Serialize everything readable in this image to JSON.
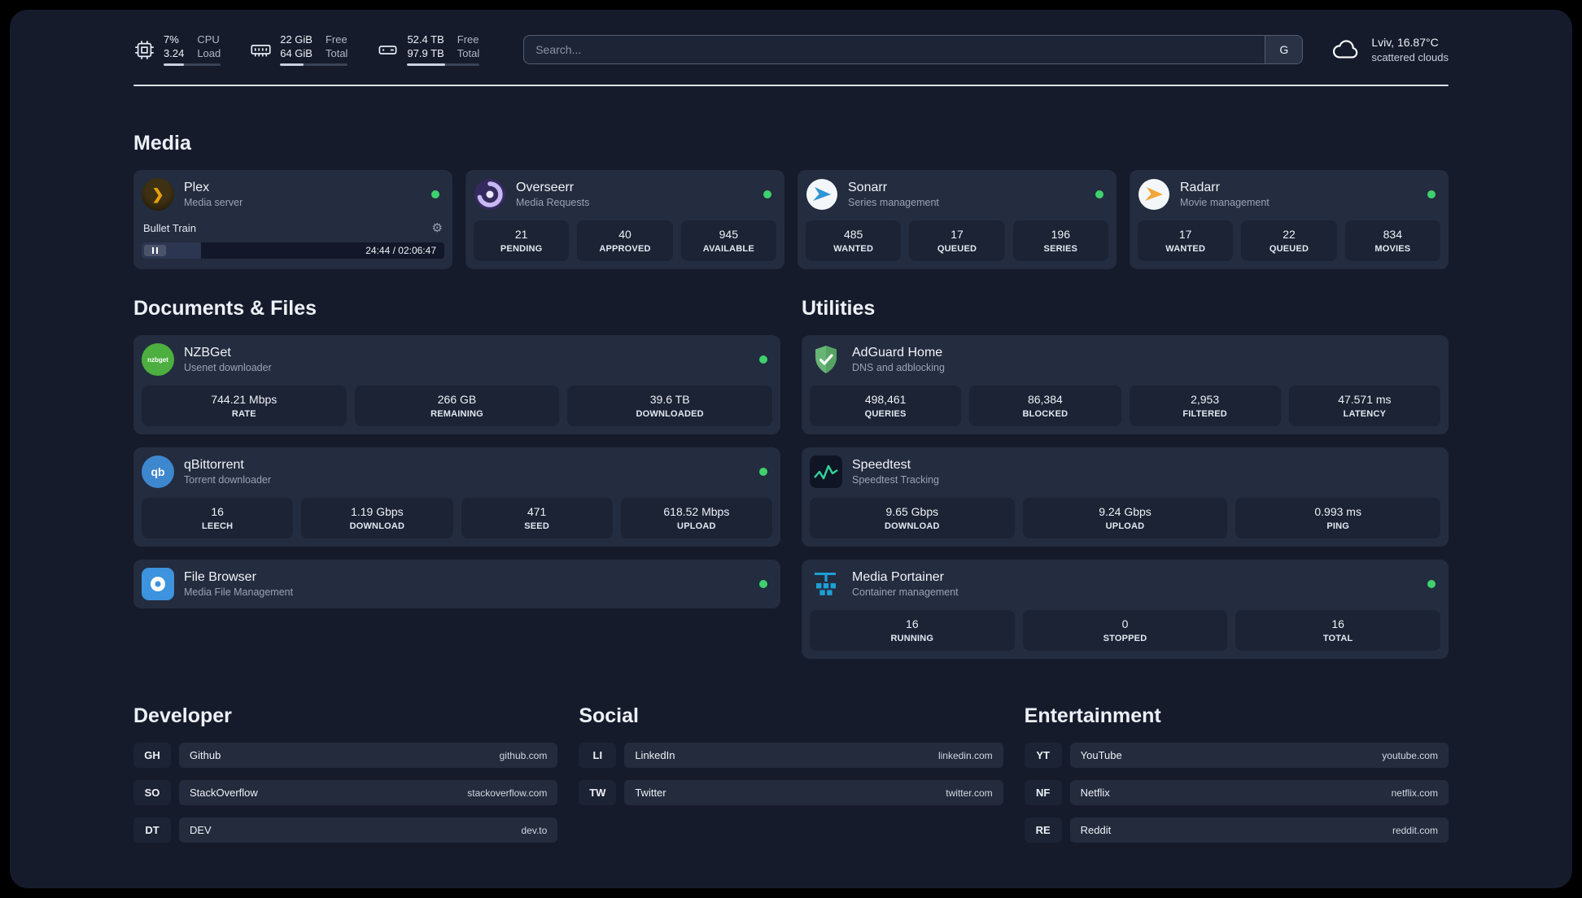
{
  "header": {
    "cpu": {
      "value1": "7%",
      "value2": "3.24",
      "label1": "CPU",
      "label2": "Load",
      "bar_pct": 35
    },
    "ram": {
      "value1": "22 GiB",
      "value2": "64 GiB",
      "label1": "Free",
      "label2": "Total",
      "bar_pct": 34
    },
    "disk": {
      "value1": "52.4 TB",
      "value2": "97.9 TB",
      "label1": "Free",
      "label2": "Total",
      "bar_pct": 53
    },
    "search": {
      "placeholder": "Search...",
      "engine_label": "G"
    },
    "weather": {
      "location": "Lviv, 16.87°C",
      "condition": "scattered clouds"
    }
  },
  "sections": {
    "media": "Media",
    "documents": "Documents & Files",
    "utilities": "Utilities",
    "developer": "Developer",
    "social": "Social",
    "entertainment": "Entertainment"
  },
  "services": {
    "plex": {
      "name": "Plex",
      "subtitle": "Media server",
      "now_playing": "Bullet Train",
      "time": "24:44 / 02:06:47",
      "progress_pct": 19.5
    },
    "overseerr": {
      "name": "Overseerr",
      "subtitle": "Media Requests",
      "stats": [
        {
          "value": "21",
          "label": "PENDING"
        },
        {
          "value": "40",
          "label": "APPROVED"
        },
        {
          "value": "945",
          "label": "AVAILABLE"
        }
      ]
    },
    "sonarr": {
      "name": "Sonarr",
      "subtitle": "Series management",
      "stats": [
        {
          "value": "485",
          "label": "WANTED"
        },
        {
          "value": "17",
          "label": "QUEUED"
        },
        {
          "value": "196",
          "label": "SERIES"
        }
      ]
    },
    "radarr": {
      "name": "Radarr",
      "subtitle": "Movie management",
      "stats": [
        {
          "value": "17",
          "label": "WANTED"
        },
        {
          "value": "22",
          "label": "QUEUED"
        },
        {
          "value": "834",
          "label": "MOVIES"
        }
      ]
    },
    "nzbget": {
      "name": "NZBGet",
      "subtitle": "Usenet downloader",
      "stats": [
        {
          "value": "744.21 Mbps",
          "label": "RATE"
        },
        {
          "value": "266 GB",
          "label": "REMAINING"
        },
        {
          "value": "39.6 TB",
          "label": "DOWNLOADED"
        }
      ]
    },
    "qbittorrent": {
      "name": "qBittorrent",
      "subtitle": "Torrent downloader",
      "stats": [
        {
          "value": "16",
          "label": "LEECH"
        },
        {
          "value": "1.19 Gbps",
          "label": "DOWNLOAD"
        },
        {
          "value": "471",
          "label": "SEED"
        },
        {
          "value": "618.52 Mbps",
          "label": "UPLOAD"
        }
      ]
    },
    "filebrowser": {
      "name": "File Browser",
      "subtitle": "Media File Management"
    },
    "adguard": {
      "name": "AdGuard Home",
      "subtitle": "DNS and adblocking",
      "stats": [
        {
          "value": "498,461",
          "label": "QUERIES"
        },
        {
          "value": "86,384",
          "label": "BLOCKED"
        },
        {
          "value": "2,953",
          "label": "FILTERED"
        },
        {
          "value": "47.571 ms",
          "label": "LATENCY"
        }
      ]
    },
    "speedtest": {
      "name": "Speedtest",
      "subtitle": "Speedtest Tracking",
      "stats": [
        {
          "value": "9.65 Gbps",
          "label": "DOWNLOAD"
        },
        {
          "value": "9.24 Gbps",
          "label": "UPLOAD"
        },
        {
          "value": "0.993 ms",
          "label": "PING"
        }
      ]
    },
    "portainer": {
      "name": "Media Portainer",
      "subtitle": "Container management",
      "stats": [
        {
          "value": "16",
          "label": "RUNNING"
        },
        {
          "value": "0",
          "label": "STOPPED"
        },
        {
          "value": "16",
          "label": "TOTAL"
        }
      ]
    }
  },
  "icons": {
    "gear": "⚙",
    "plex_glyph": "❯",
    "nzbget_glyph": "nzbget",
    "qbittorrent_glyph": "qb"
  },
  "bookmarks": {
    "developer": [
      {
        "abbr": "GH",
        "name": "Github",
        "url": "github.com"
      },
      {
        "abbr": "SO",
        "name": "StackOverflow",
        "url": "stackoverflow.com"
      },
      {
        "abbr": "DT",
        "name": "DEV",
        "url": "dev.to"
      }
    ],
    "social": [
      {
        "abbr": "LI",
        "name": "LinkedIn",
        "url": "linkedin.com"
      },
      {
        "abbr": "TW",
        "name": "Twitter",
        "url": "twitter.com"
      }
    ],
    "entertainment": [
      {
        "abbr": "YT",
        "name": "YouTube",
        "url": "youtube.com"
      },
      {
        "abbr": "NF",
        "name": "Netflix",
        "url": "netflix.com"
      },
      {
        "abbr": "RE",
        "name": "Reddit",
        "url": "reddit.com"
      }
    ]
  },
  "colors": {
    "status_online_green": "#3ed16d",
    "plex_amber": "#e5a00d",
    "nzbget_green": "#4caf3f",
    "qbittorrent_blue": "#3d87cf",
    "sonarr_blue": "#3095d4",
    "radarr_amber": "#f0a73a",
    "overseerr_purple": "#a78bfa",
    "adguard_green": "#66b574",
    "speedtest_green": "#34d399",
    "filebrowser_blue": "#3d93dd",
    "portainer_blue": "#1d9fd6"
  }
}
